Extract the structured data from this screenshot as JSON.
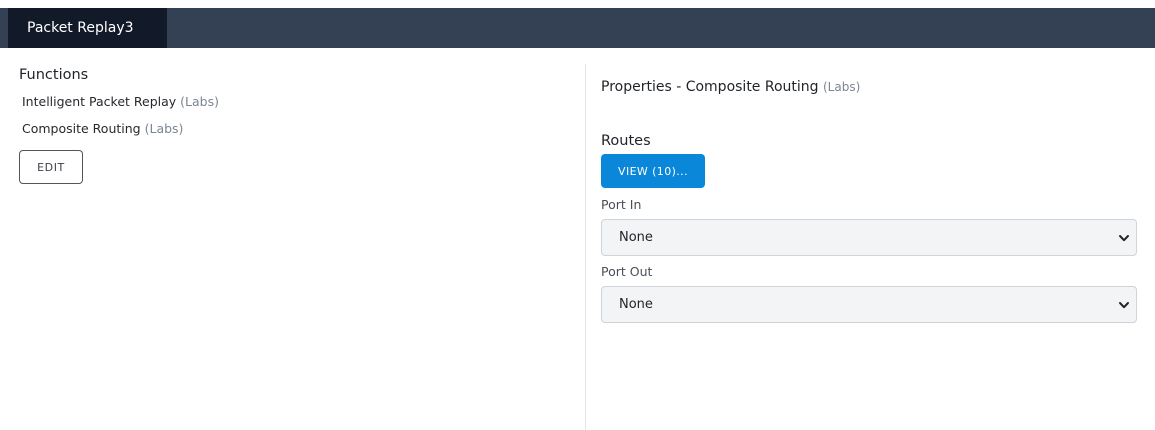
{
  "tabs": [
    {
      "label": "Packet Replay3",
      "active": true
    }
  ],
  "functions": {
    "title": "Functions",
    "items": [
      {
        "name": "Intelligent Packet Replay",
        "tag": "(Labs)"
      },
      {
        "name": "Composite Routing",
        "tag": "(Labs)"
      }
    ],
    "edit_label": "EDIT"
  },
  "properties": {
    "title": "Properties  - Composite Routing",
    "tag": "(Labs)",
    "routes_label": "Routes",
    "view_label": "VIEW (10)...",
    "port_in": {
      "label": "Port In",
      "value": "None"
    },
    "port_out": {
      "label": "Port Out",
      "value": "None"
    }
  },
  "colors": {
    "topbar": "#344154",
    "active_tab": "#121a2a",
    "primary_button": "#0a87d8",
    "labs_tag": "#7b8694"
  },
  "icons": {
    "select_arrow": "chevron-down-icon"
  }
}
